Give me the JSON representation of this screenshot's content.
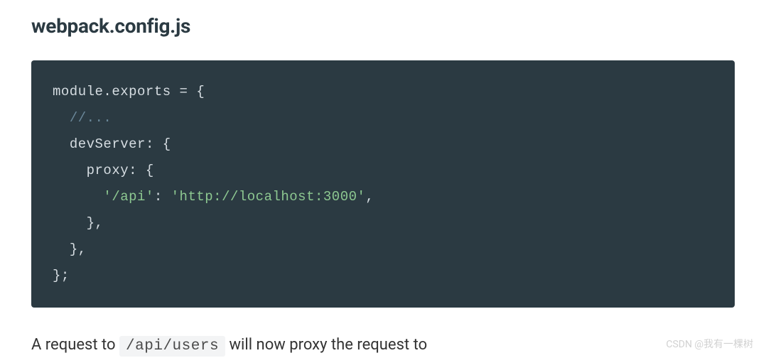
{
  "heading": "webpack.config.js",
  "code": {
    "l1_pre": "module",
    "l1_dot": ".",
    "l1_exports": "exports",
    "l1_eq": " = ",
    "l1_brace": "{",
    "l2_indent": "  ",
    "l2_comment": "//...",
    "l3_indent": "  ",
    "l3_key": "devServer",
    "l3_colon": ":",
    "l3_brace": " {",
    "l4_indent": "    ",
    "l4_key": "proxy",
    "l4_colon": ":",
    "l4_brace": " {",
    "l5_indent": "      ",
    "l5_key": "'/api'",
    "l5_colon": ":",
    "l5_val": " 'http://localhost:3000'",
    "l5_comma": ",",
    "l6_indent": "    ",
    "l6_brace": "}",
    "l6_comma": ",",
    "l7_indent": "  ",
    "l7_brace": "}",
    "l7_comma": ",",
    "l8_brace": "}",
    "l8_semi": ";"
  },
  "paragraph": {
    "t1": "A request to ",
    "inline": "/api/users",
    "t2": " will now proxy the request to"
  },
  "watermark": "CSDN @我有一棵树"
}
